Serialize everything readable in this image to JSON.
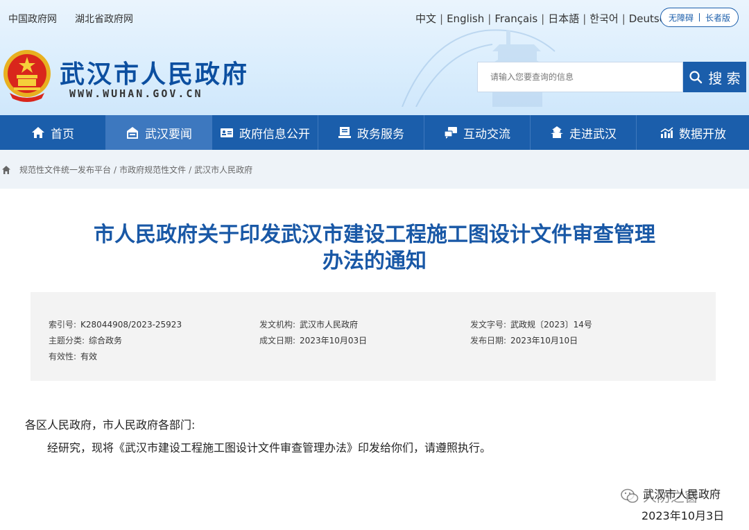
{
  "header": {
    "top_links": [
      "中国政府网",
      "湖北省政府网"
    ],
    "languages": [
      "中文",
      "English",
      "Français",
      "日本語",
      "한국어",
      "Deutsch"
    ],
    "accessibility": {
      "barrier_free": "无障碍",
      "elder": "长者版"
    },
    "site_title": "武汉市人民政府",
    "site_url": "WWW.WUHAN.GOV.CN",
    "search": {
      "placeholder": "请输入您要查询的信息",
      "button": "搜 索"
    }
  },
  "nav": {
    "items": [
      {
        "label": "首页",
        "icon": "home-icon"
      },
      {
        "label": "武汉要闻",
        "icon": "news-icon",
        "active": true
      },
      {
        "label": "政府信息公开",
        "icon": "info-card-icon"
      },
      {
        "label": "政务服务",
        "icon": "service-icon"
      },
      {
        "label": "互动交流",
        "icon": "chat-icon"
      },
      {
        "label": "走进武汉",
        "icon": "pavilion-icon"
      },
      {
        "label": "数据开放",
        "icon": "chart-icon"
      }
    ]
  },
  "breadcrumb": {
    "items": [
      "规范性文件统一发布平台",
      "市政府规范性文件",
      "武汉市人民政府"
    ],
    "separator": "/"
  },
  "article": {
    "title_line1": "市人民政府关于印发武汉市建设工程施工图设计文件审查管理",
    "title_line2": "办法的通知",
    "meta": {
      "index_no": {
        "key": "索引号:",
        "value": "K28044908/2023-25923"
      },
      "issuer": {
        "key": "发文机构:",
        "value": "武汉市人民政府"
      },
      "doc_no": {
        "key": "发文字号:",
        "value": "武政规〔2023〕14号"
      },
      "topic": {
        "key": "主题分类:",
        "value": "综合政务"
      },
      "created": {
        "key": "成文日期:",
        "value": "2023年10月03日"
      },
      "published": {
        "key": "发布日期:",
        "value": "2023年10月10日"
      },
      "validity": {
        "key": "有效性:",
        "value": "有效"
      }
    },
    "salutation": "各区人民政府，市人民政府各部门:",
    "body": "经研究，现将《武汉市建设工程施工图设计文件审查管理办法》印发给你们，请遵照执行。",
    "signature_org": "武汉市人民政府",
    "signature_date": "2023年10月3日",
    "watermark": "人防之窗"
  },
  "colors": {
    "primary": "#1b5eab",
    "title": "#1958a6",
    "nav_active": "#3d78bf"
  }
}
